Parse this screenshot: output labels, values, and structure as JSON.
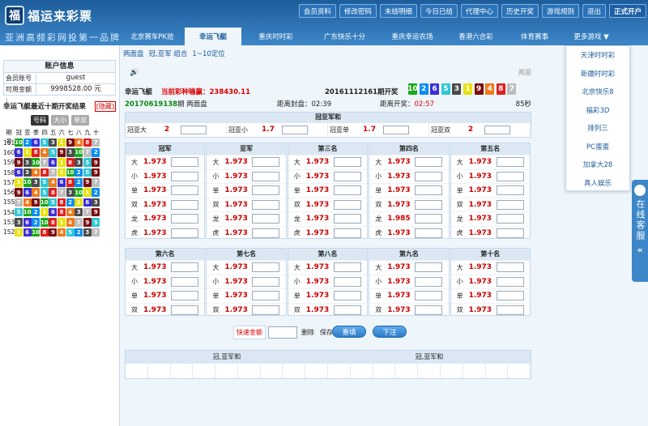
{
  "brand": {
    "logo_char": "福",
    "name": "福运来彩票",
    "slogan": "亚洲高频彩网投第一品牌"
  },
  "top_buttons": [
    "会员资料",
    "修改密码",
    "未结明细",
    "今日已结",
    "代理中心",
    "历史开奖",
    "游戏规则",
    "退出",
    "正式开户"
  ],
  "nav": [
    "北京赛车PK拾",
    "幸运飞艇",
    "重庆时时彩",
    "广东快乐十分",
    "重庆幸运农场",
    "香港六合彩",
    "体育赛事",
    "更多游戏 ▼"
  ],
  "nav_active": 1,
  "dropdown": [
    "天津时时彩",
    "新疆时时彩",
    "北京快乐8",
    "福彩3D",
    "排列三",
    "PC蛋蛋",
    "加拿大28",
    "真人娱乐"
  ],
  "side_tab": {
    "label": "在线客服",
    "chevron": "«"
  },
  "account": {
    "title": "账户信息",
    "rows": [
      {
        "k": "会员账号 :",
        "v": "guest"
      },
      {
        "k": "可用金额 :",
        "v": "9998528.00 元"
      }
    ]
  },
  "history": {
    "title": "幸运飞艇最近十期开奖结果",
    "hide": "[隐藏]",
    "tabs": [
      "号码",
      "大小",
      "单双"
    ],
    "headers": [
      "期号",
      "冠",
      "亚",
      "季",
      "四",
      "五",
      "六",
      "七",
      "八",
      "九",
      "十"
    ],
    "rows": [
      {
        "p": "161",
        "n": [
          10,
          2,
          6,
          5,
          3,
          1,
          9,
          4,
          8,
          7
        ]
      },
      {
        "p": "160",
        "n": [
          6,
          1,
          8,
          4,
          5,
          9,
          3,
          10,
          7,
          2
        ]
      },
      {
        "p": "159",
        "n": [
          9,
          3,
          10,
          7,
          6,
          1,
          8,
          3,
          5,
          9
        ]
      },
      {
        "p": "158",
        "n": [
          6,
          3,
          4,
          8,
          7,
          1,
          10,
          2,
          5,
          9
        ]
      },
      {
        "p": "157",
        "n": [
          1,
          10,
          3,
          5,
          4,
          6,
          8,
          2,
          9,
          7
        ]
      },
      {
        "p": "156",
        "n": [
          9,
          6,
          4,
          5,
          8,
          7,
          3,
          10,
          1,
          2
        ]
      },
      {
        "p": "155",
        "n": [
          7,
          4,
          9,
          10,
          5,
          8,
          2,
          1,
          6,
          3
        ]
      },
      {
        "p": "154",
        "n": [
          5,
          10,
          2,
          1,
          6,
          8,
          4,
          3,
          7,
          9
        ]
      },
      {
        "p": "153",
        "n": [
          3,
          6,
          2,
          10,
          8,
          1,
          4,
          7,
          9,
          5
        ]
      },
      {
        "p": "152",
        "n": [
          1,
          6,
          10,
          8,
          9,
          4,
          5,
          2,
          3,
          7
        ]
      }
    ]
  },
  "subtabs": [
    "两面盘",
    "冠,亚军 组合",
    "1~10定位"
  ],
  "right_gray": "两面",
  "info": {
    "game": "幸运飞艇",
    "accum": "当前彩种输赢：238430.11",
    "issue": "20161112161期开奖",
    "balls": [
      10,
      2,
      6,
      5,
      3,
      1,
      9,
      4,
      8,
      7
    ],
    "issue2": "20170619138",
    "issue2_suffix": "期 两面盘",
    "close_label": "距离封盘：02:39",
    "open_prefix": "距离开奖：",
    "open_time": "02:57",
    "right": "85秒"
  },
  "gy": {
    "title": "冠亚军和",
    "cells": [
      {
        "l": "冠亚大",
        "o": "2"
      },
      {
        "l": "冠亚小",
        "o": "1.7"
      },
      {
        "l": "冠亚单",
        "o": "1.7"
      },
      {
        "l": "冠亚双",
        "o": "2"
      }
    ]
  },
  "odds_default": "1.973",
  "odds_dragon4": "1.985",
  "group1": [
    {
      "title": "冠军",
      "rows": [
        "大",
        "小",
        "单",
        "双",
        "龙",
        "虎"
      ]
    },
    {
      "title": "亚军",
      "rows": [
        "大",
        "小",
        "单",
        "双",
        "龙",
        "虎"
      ]
    },
    {
      "title": "第三名",
      "rows": [
        "大",
        "小",
        "单",
        "双",
        "龙",
        "虎"
      ]
    },
    {
      "title": "第四名",
      "rows": [
        "大",
        "小",
        "单",
        "双",
        "龙",
        "虎"
      ]
    },
    {
      "title": "第五名",
      "rows": [
        "大",
        "小",
        "单",
        "双",
        "龙",
        "虎"
      ]
    }
  ],
  "group2": [
    {
      "title": "第六名",
      "rows": [
        "大",
        "小",
        "单",
        "双"
      ]
    },
    {
      "title": "第七名",
      "rows": [
        "大",
        "小",
        "单",
        "双"
      ]
    },
    {
      "title": "第八名",
      "rows": [
        "大",
        "小",
        "单",
        "双"
      ]
    },
    {
      "title": "第九名",
      "rows": [
        "大",
        "小",
        "单",
        "双"
      ]
    },
    {
      "title": "第十名",
      "rows": [
        "大",
        "小",
        "单",
        "双"
      ]
    }
  ],
  "quick": {
    "label": "快速金额",
    "del": "删除",
    "save": "保存"
  },
  "buttons": {
    "reset": "重填",
    "submit": "下注"
  },
  "bottom_table": [
    "冠,亚军和",
    "冠,亚军和"
  ],
  "colors": {
    "ball": [
      "#e8e210",
      "#0a8ef0",
      "#4b4b4b",
      "#ef7a1a",
      "#2fc6d6",
      "#3a2ed8",
      "#bdbdbd",
      "#e0201f",
      "#7a0d0f",
      "#1aa81a"
    ]
  }
}
